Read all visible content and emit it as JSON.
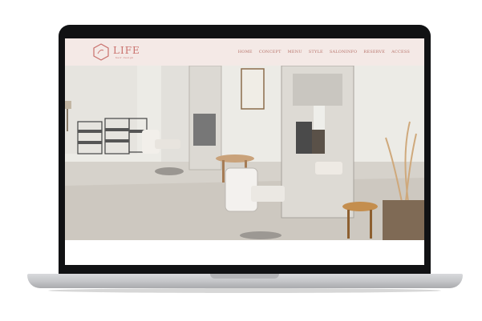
{
  "site": {
    "logo_text": "LIFE",
    "logo_sub": "hair design",
    "nav": [
      "HOME",
      "CONCEPT",
      "MENU",
      "STYLE",
      "SALONINFO",
      "RESERVE",
      "ACCESS"
    ]
  },
  "colors": {
    "brand": "#c9706c",
    "header_bg": "#f4e9e6",
    "bezel": "#111214"
  },
  "icons": {
    "logo": "hexagon-logo-icon"
  }
}
